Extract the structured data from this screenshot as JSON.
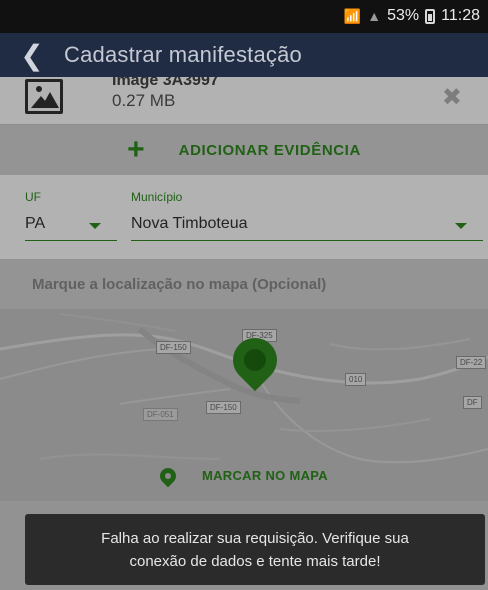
{
  "status_bar": {
    "battery_percent": "53%",
    "time": "11:28"
  },
  "app_bar": {
    "title": "Cadastrar manifestação"
  },
  "attachment": {
    "file_name": "Image 3A3997",
    "file_size": "0.27 MB"
  },
  "evidence": {
    "add_label": "ADICIONAR EVIDÊNCIA"
  },
  "form": {
    "uf_label": "UF",
    "uf_value": "PA",
    "municipio_label": "Município",
    "municipio_value": "Nova Timboteua"
  },
  "map": {
    "hint": "Marque a localização no mapa (Opcional)",
    "road_labels": [
      "DF-150",
      "DF-325",
      "010",
      "DF-22",
      "DF-150",
      "DF-051",
      "DF"
    ],
    "mark_label": "MARCAR NO MAPA"
  },
  "toast": {
    "line1": "Falha ao realizar sua requisição. Verifique sua",
    "line2": "conexão de dados e tente mais tarde!"
  },
  "colors": {
    "accent_green": "#2e8b1f",
    "app_bar": "#202c44",
    "status_bar": "#111111",
    "toast_bg": "#2b2b2b"
  },
  "icons": [
    "wifi-icon",
    "signal-icon",
    "battery-icon",
    "back-arrow-icon",
    "image-file-icon",
    "close-icon",
    "plus-icon",
    "dropdown-caret-icon",
    "map-pin-icon"
  ]
}
